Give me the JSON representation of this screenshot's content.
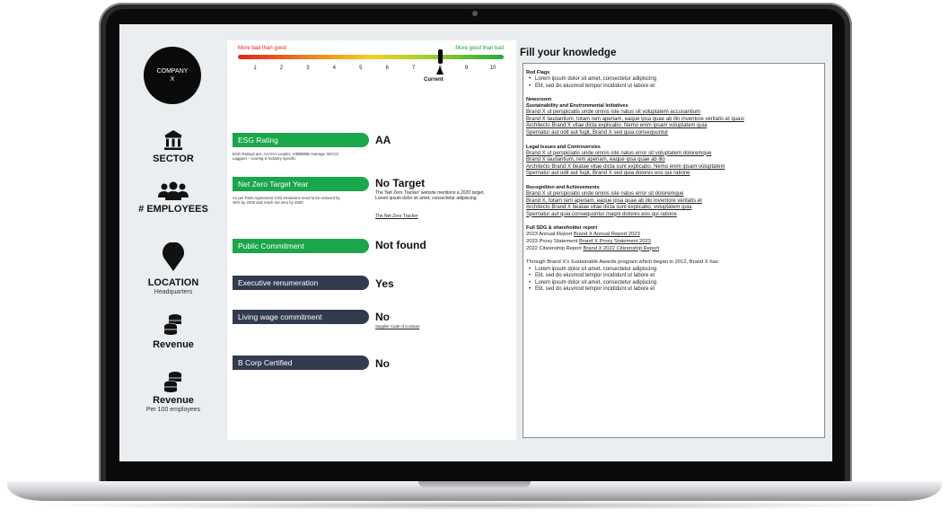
{
  "sidebar": {
    "company_line1": "COMPANY",
    "company_line2": "X",
    "sector_label": "SECTOR",
    "employees_label": "# EMPLOYEES",
    "location_label": "LOCATION",
    "location_sub": "Headquarters",
    "revenue_label": "Revenue",
    "revenue2_label": "Revenue",
    "revenue2_sub": "Per 100 employees"
  },
  "scale": {
    "left_label": "More bad than good",
    "right_label": "More good than bad",
    "numbers": [
      "1",
      "2",
      "3",
      "4",
      "5",
      "6",
      "7",
      "8",
      "9",
      "10"
    ],
    "current_label": "Current",
    "current_value": 8
  },
  "metrics": [
    {
      "label": "ESG Rating",
      "value": "AA",
      "note": "ESG Ratings are: AAA/AA Leader; A/BBB/BB Average; B/CCC Laggard – scoring is industry specific"
    },
    {
      "label": "Net Zero Target Year",
      "value": "No Target",
      "note": "As per Paris Agreement CO2 emissions need to be reduced by 45% by 2030 and reach net zero by 2050",
      "detail": "The 'Net Zero Tracker' website mentions a 2020 target, Lorem ipsum dolor sit amet, consectetur adipiscing",
      "link": "The Net Zero Tracker"
    },
    {
      "label": "Public Commitment",
      "value": "Not found"
    },
    {
      "label": "Executive renumeration",
      "value": "Yes"
    },
    {
      "label": "Living wage commitment",
      "value": "No",
      "link": "Supplier Code of Conduct"
    },
    {
      "label": "B Corp Certified",
      "value": "No"
    }
  ],
  "knowledge": {
    "title": "Fill your knowledge",
    "red_flags": {
      "heading": "Red Flags",
      "items": [
        "Lorem ipsum dolor sit amet, consectetur adipiscing",
        "Elit, sed do eiusmod tempor incididunt ut labore et"
      ]
    },
    "newsroom": {
      "heading": "Newsroom",
      "sustainability": {
        "heading": "Sustainability and Environmental Initiatives",
        "links": [
          "Brand X ut perspiciatis unde omnis iste natus sit voluptatem accusantium",
          "Brand X laudantium, totam rem aperiam, eaque ipsa quae ab illo inventore veritatis et quasi",
          "Architecto Brand X vitae dicta explicabo. Nemo enim ipsam voluptatem quia",
          "Spernatur aut odit aut fugit, Brand X sed quia consequuntur"
        ]
      },
      "legal": {
        "heading": "Legal Issues and Controversies",
        "links": [
          "Brand X ut perspiciatis unde omnis iste natus error sit voluptatem doloremque",
          "Brand X laudantium, rem aperiam, eaque ipsa quae ab illo",
          "Architecto Brand X beatae vitae dicta sunt explicabo. Nemo enim ipsam voluptatem",
          "Spernatur aut odit aut fugit, Brand X sed quia dolores eos qui ratione"
        ]
      },
      "recognition": {
        "heading": "Recognition and Achievements",
        "links": [
          "Brand X ut perspiciatis unde omnis iste natus error sit doloremque",
          "Brand X, totam rem aperiam, eaque ipsa quae ab illo inventore veritatis et",
          "Architecto Brand X beatae vitae dicta sunt explicabo, voluptatem quia",
          "Spernatur aut quia consequuntur magni dolores eos qui ratione"
        ]
      }
    },
    "reports": {
      "heading": "Full SDG & shareholder report",
      "rows": [
        {
          "label": "2023 Annual Report",
          "link": "Brand X Annual Report 2023"
        },
        {
          "label": "2023 Proxy Statement",
          "link": "Brand X Proxy Statement 2023"
        },
        {
          "label": "2022 Citizenship Report",
          "link": "Brand X 2022 Citizenship Report"
        }
      ]
    },
    "awards": {
      "intro": "Through Brand X's Sustainable Awards program which began in 2012, Brand X has:",
      "items": [
        "Lorem ipsum dolor sit amet, consectetur adipiscing",
        "Elit, sed do eiusmod tempor incididunt ut labore et",
        "Lorem ipsum dolor sit amet, consectetur adipiscing",
        "Elit, sed do eiusmod tempor incididunt ut labore et"
      ]
    }
  },
  "colors": {
    "pill_green": "#1aa64a",
    "pill_navy": "#333b4f",
    "bad_red": "#e62323",
    "good_green": "#23a03c"
  }
}
